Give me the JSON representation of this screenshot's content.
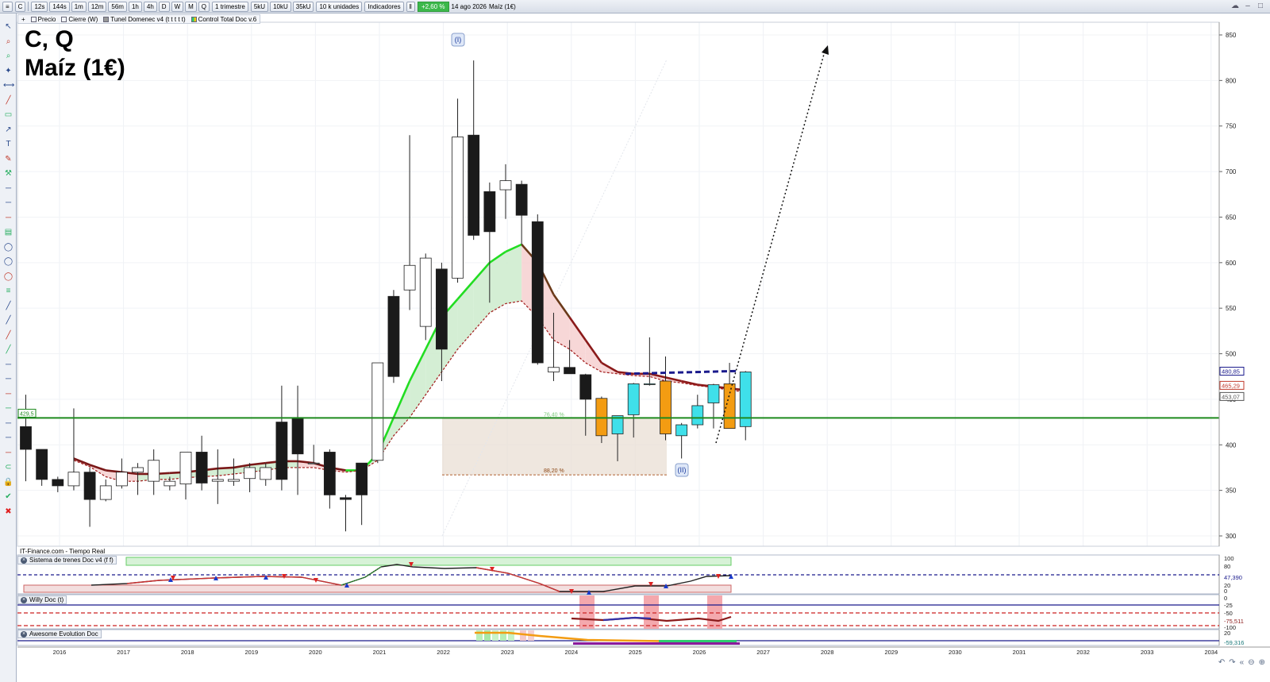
{
  "toolbar": {
    "symbol": "C",
    "timeframes": [
      "12s",
      "144s",
      "1m",
      "12m",
      "56m",
      "1h",
      "4h",
      "D",
      "W",
      "M",
      "Q"
    ],
    "period": "1 trimestre",
    "units": [
      "5kU",
      "10kU",
      "35kU"
    ],
    "units_select": "10 k unidades",
    "indicators_label": "Indicadores",
    "change": "+2,60 %",
    "date": "14 ago 2026",
    "instrument": "Maíz (1€)"
  },
  "legend": {
    "items": [
      "Precio",
      "Cierre (W)",
      "Tunel Domenec v4 (t t t t t)",
      "Control Total Doc v.6"
    ]
  },
  "title": {
    "line1": "C, Q",
    "line2": "Maíz (1€)"
  },
  "source": "IT-Finance.com - Tiempo Real",
  "annotations": {
    "wave1": "(I)",
    "wave2": "(II)",
    "fib_764": "76,40 %",
    "fib_882": "88,20 %",
    "hline_label": "429,5"
  },
  "price_axis": {
    "ticks": [
      "850",
      "800",
      "750",
      "700",
      "650",
      "600",
      "550",
      "500",
      "450",
      "400",
      "350",
      "300"
    ],
    "markers": [
      {
        "text": "480,85",
        "color": "#1a1a8c"
      },
      {
        "text": "465,29",
        "color": "#c0392b"
      },
      {
        "text": "453,07",
        "color": "#555555"
      }
    ]
  },
  "time_axis": {
    "labels": [
      "2016",
      "2017",
      "2018",
      "2019",
      "2020",
      "2021",
      "2022",
      "2023",
      "2024",
      "2025",
      "2026",
      "2027",
      "2028",
      "2029",
      "2030",
      "2031",
      "2032",
      "2033",
      "2034"
    ]
  },
  "indicators": [
    {
      "name": "Sistema de trenes Doc v4 (f f)",
      "axis": [
        "100",
        "80",
        "47,390",
        "20",
        "0"
      ]
    },
    {
      "name": "Willy Doc (t)",
      "axis": [
        "0",
        "-25",
        "-50",
        "-75,511",
        "-100"
      ]
    },
    {
      "name": "Awesome Evolution Doc",
      "axis": [
        "20",
        "-59,316"
      ]
    }
  ],
  "chart_data": {
    "type": "candlestick",
    "interval": "quarterly",
    "ylim": [
      280,
      870
    ],
    "hline": 429.5,
    "candles": [
      {
        "o": 420,
        "h": 455,
        "l": 360,
        "c": 395
      },
      {
        "o": 395,
        "h": 395,
        "l": 355,
        "c": 362
      },
      {
        "o": 362,
        "h": 365,
        "l": 348,
        "c": 355
      },
      {
        "o": 355,
        "h": 440,
        "l": 350,
        "c": 370
      },
      {
        "o": 370,
        "h": 375,
        "l": 310,
        "c": 340
      },
      {
        "o": 340,
        "h": 362,
        "l": 338,
        "c": 355
      },
      {
        "o": 355,
        "h": 385,
        "l": 352,
        "c": 370
      },
      {
        "o": 370,
        "h": 380,
        "l": 345,
        "c": 375
      },
      {
        "o": 360,
        "h": 395,
        "l": 345,
        "c": 383
      },
      {
        "o": 355,
        "h": 365,
        "l": 350,
        "c": 360
      },
      {
        "o": 357,
        "h": 390,
        "l": 340,
        "c": 392
      },
      {
        "o": 392,
        "h": 410,
        "l": 350,
        "c": 358
      },
      {
        "o": 360,
        "h": 395,
        "l": 335,
        "c": 362
      },
      {
        "o": 360,
        "h": 385,
        "l": 355,
        "c": 362
      },
      {
        "o": 363,
        "h": 380,
        "l": 348,
        "c": 375
      },
      {
        "o": 362,
        "h": 380,
        "l": 355,
        "c": 375
      },
      {
        "o": 425,
        "h": 465,
        "l": 350,
        "c": 362
      },
      {
        "o": 430,
        "h": 465,
        "l": 345,
        "c": 390
      },
      {
        "o": 380,
        "h": 400,
        "l": 380,
        "c": 380
      },
      {
        "o": 392,
        "h": 395,
        "l": 330,
        "c": 345
      },
      {
        "o": 342,
        "h": 345,
        "l": 305,
        "c": 340
      },
      {
        "o": 380,
        "h": 380,
        "l": 312,
        "c": 345
      },
      {
        "o": 383,
        "h": 490,
        "l": 380,
        "c": 490
      },
      {
        "o": 563,
        "h": 570,
        "l": 468,
        "c": 475
      },
      {
        "o": 570,
        "h": 740,
        "l": 548,
        "c": 597
      },
      {
        "o": 530,
        "h": 610,
        "l": 515,
        "c": 605
      },
      {
        "o": 593,
        "h": 600,
        "l": 470,
        "c": 505
      },
      {
        "o": 583,
        "h": 780,
        "l": 578,
        "c": 738
      },
      {
        "o": 740,
        "h": 822,
        "l": 625,
        "c": 630
      },
      {
        "o": 678,
        "h": 688,
        "l": 556,
        "c": 634
      },
      {
        "o": 680,
        "h": 708,
        "l": 648,
        "c": 690
      },
      {
        "o": 686,
        "h": 690,
        "l": 620,
        "c": 652
      },
      {
        "o": 645,
        "h": 653,
        "l": 488,
        "c": 490
      },
      {
        "o": 480,
        "h": 545,
        "l": 470,
        "c": 485
      },
      {
        "o": 485,
        "h": 515,
        "l": 478,
        "c": 478
      },
      {
        "o": 477,
        "h": 478,
        "l": 410,
        "c": 450
      },
      {
        "o": 451,
        "h": 453,
        "l": 402,
        "c": 410
      },
      {
        "o": 412,
        "h": 432,
        "l": 382,
        "c": 432
      },
      {
        "o": 433,
        "h": 468,
        "l": 408,
        "c": 467
      },
      {
        "o": 467,
        "h": 518,
        "l": 465,
        "c": 467
      },
      {
        "o": 470,
        "h": 497,
        "l": 405,
        "c": 412
      },
      {
        "o": 410,
        "h": 424,
        "l": 385,
        "c": 422
      },
      {
        "o": 422,
        "h": 455,
        "l": 418,
        "c": 443
      },
      {
        "o": 446,
        "h": 467,
        "l": 418,
        "c": 466
      },
      {
        "o": 467,
        "h": 490,
        "l": 420,
        "c": 418
      },
      {
        "o": 420,
        "h": 481,
        "l": 405,
        "c": 480
      }
    ],
    "candle_colors": {
      "up": "#ffffff",
      "down": "#1a1a1a",
      "orange": "#f39c12",
      "cyan": "#3fe0ea"
    },
    "colored_from_index": 36,
    "colored_sequence": [
      "orange",
      "cyan",
      "cyan",
      "cyan",
      "orange",
      "cyan",
      "cyan",
      "cyan",
      "orange",
      "cyan"
    ],
    "tunnel_upper": [
      null,
      null,
      null,
      385,
      378,
      372,
      370,
      368,
      368,
      369,
      370,
      372,
      374,
      375,
      378,
      380,
      382,
      382,
      380,
      375,
      372,
      372,
      390,
      430,
      470,
      505,
      540,
      560,
      580,
      600,
      612,
      620,
      600,
      565,
      540,
      515,
      490,
      480,
      478,
      478,
      474,
      470,
      466,
      464,
      462,
      460
    ],
    "tunnel_lower": [
      null,
      null,
      null,
      383,
      376,
      365,
      360,
      360,
      362,
      362,
      364,
      365,
      366,
      368,
      370,
      372,
      375,
      375,
      375,
      372,
      370,
      372,
      383,
      410,
      430,
      455,
      480,
      505,
      525,
      545,
      555,
      558,
      540,
      515,
      505,
      490,
      480,
      478,
      476,
      475,
      470,
      468,
      465,
      463,
      460,
      458
    ]
  }
}
